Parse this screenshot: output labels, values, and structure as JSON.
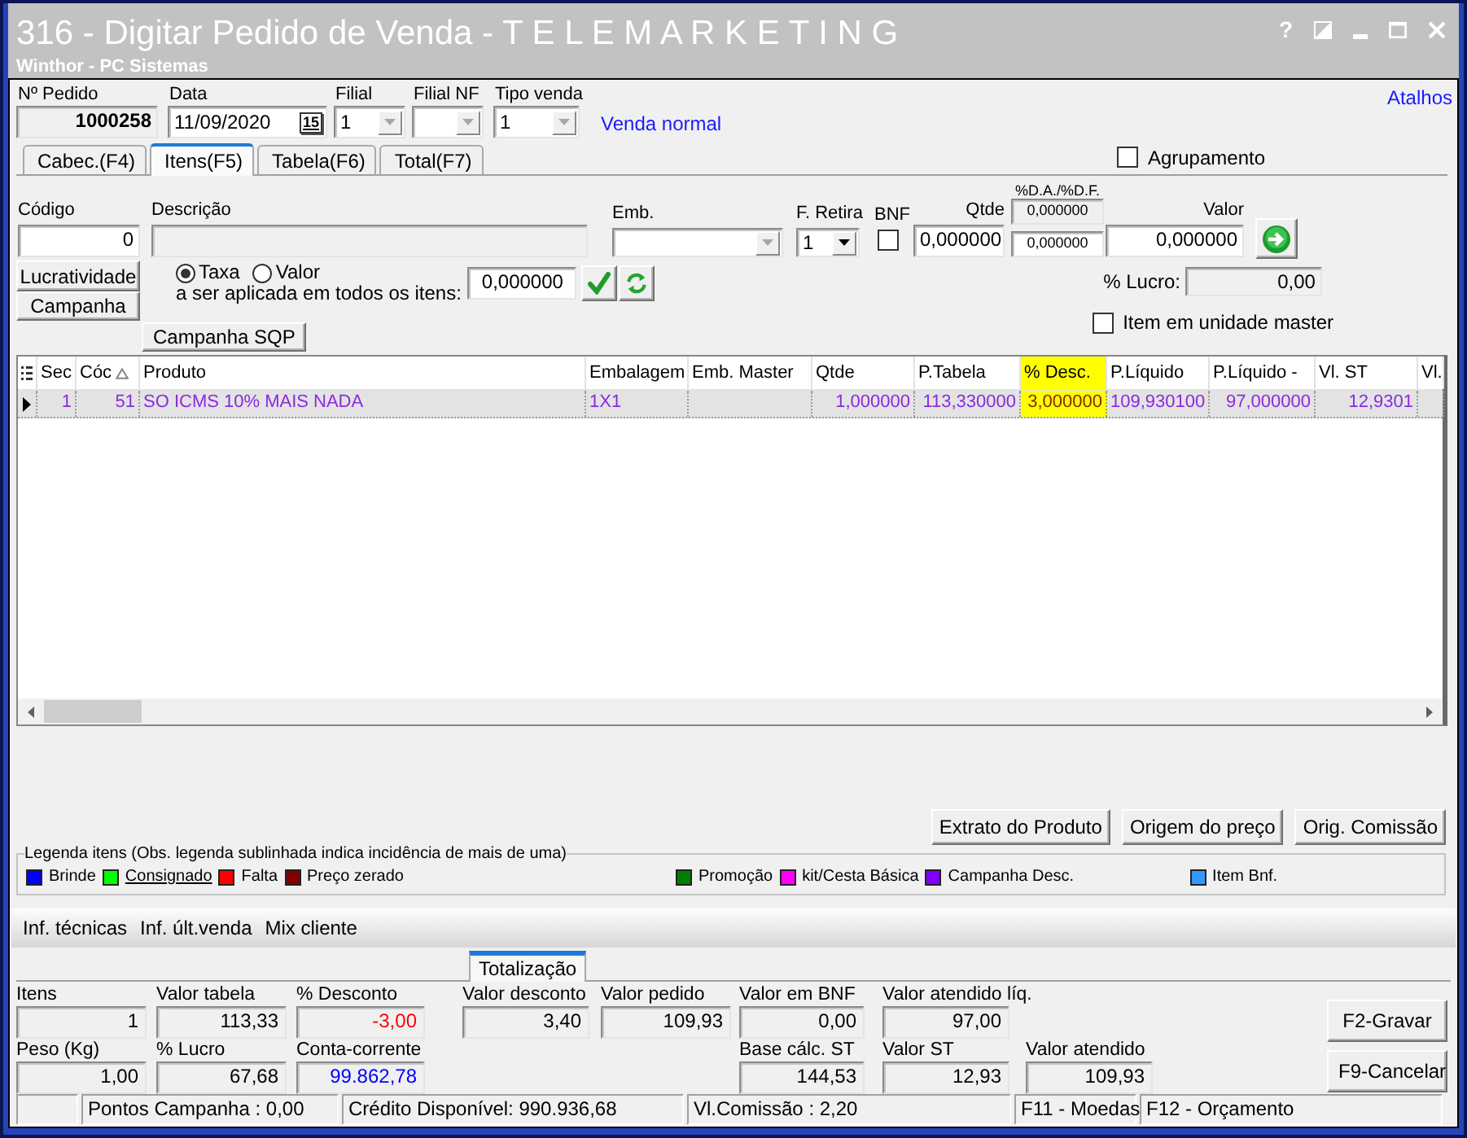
{
  "window": {
    "title": "316 - Digitar Pedido de Venda - T E L E M A R K E T I N G",
    "subtitle": "Winthor - PC Sistemas",
    "help": "?"
  },
  "shortcuts_link": "Atalhos",
  "header_fields": [
    {
      "kind": "text",
      "label": "Nº Pedido",
      "value": "1000258"
    },
    {
      "kind": "date",
      "label": "Data",
      "value": "11/09/2020",
      "button": "15"
    },
    {
      "kind": "dropdown",
      "label": "Filial",
      "value": "1",
      "disabled": true
    },
    {
      "kind": "dropdown",
      "label": "Filial NF",
      "disabled": true
    },
    {
      "kind": "dropdown",
      "label": "Tipo venda",
      "value": "1",
      "disabled": true
    }
  ],
  "sale_type_link": "Venda normal",
  "tabs": [
    {
      "label": "Cabec.(F4)",
      "selected": false
    },
    {
      "label": "Itens(F5)",
      "selected": true
    },
    {
      "label": "Tabela(F6)",
      "selected": false
    },
    {
      "label": "Total(F7)",
      "selected": false
    }
  ],
  "grouping": {
    "label": "Agrupamento",
    "checked": false
  },
  "entry_fields": [
    {
      "kind": "text",
      "label": "Código",
      "value": "0"
    },
    {
      "kind": "readonly",
      "label": "Descrição"
    },
    {
      "kind": "dropdown",
      "label": "Emb.",
      "disabled": true
    },
    {
      "kind": "dropdown",
      "label": "F. Retira",
      "value": "1",
      "disabled": false
    },
    {
      "kind": "checkbox",
      "label": "BNF",
      "checked": false
    },
    {
      "kind": "text",
      "label": "Qtde",
      "value": "0,000000"
    },
    {
      "kind": "pair",
      "label": "%D.A./%D.F.",
      "values": [
        "0,000000",
        "0,000000"
      ]
    },
    {
      "kind": "text",
      "label": "Valor",
      "value": "0,000000"
    }
  ],
  "side_buttons": [
    "Lucratividade",
    "Campanha"
  ],
  "discount": {
    "options": [
      {
        "label": "Taxa",
        "selected": true
      },
      {
        "label": "Valor",
        "selected": false
      }
    ],
    "caption": "a ser aplicada em todos os itens:",
    "value": "0,000000"
  },
  "profit": {
    "label": "% Lucro:",
    "value": "0,00"
  },
  "master_unit": {
    "label": "Item em unidade master",
    "checked": false
  },
  "campaign_sqp_button": "Campanha SQP",
  "items_table": {
    "columns": [
      {
        "label": "Sec",
        "sorted": false,
        "highlighted": false
      },
      {
        "label": "Cóc",
        "sorted": true,
        "highlighted": false
      },
      {
        "label": "Produto",
        "sorted": false,
        "highlighted": false
      },
      {
        "label": "Embalagem",
        "sorted": false,
        "highlighted": false
      },
      {
        "label": "Emb. Master",
        "sorted": false,
        "highlighted": false
      },
      {
        "label": "Qtde",
        "sorted": false,
        "highlighted": false
      },
      {
        "label": "P.Tabela",
        "sorted": false,
        "highlighted": false
      },
      {
        "label": "% Desc.",
        "sorted": false,
        "highlighted": true
      },
      {
        "label": "P.Líquido",
        "sorted": false,
        "highlighted": false
      },
      {
        "label": "P.Líquido -",
        "sorted": false,
        "highlighted": false
      },
      {
        "label": "Vl. ST",
        "sorted": false,
        "highlighted": false
      },
      {
        "label": "Vl.",
        "sorted": false,
        "highlighted": false
      }
    ],
    "rows": [
      {
        "selected": true,
        "color": "#8a2be2",
        "cells": [
          "1",
          "51",
          "SO ICMS 10% MAIS NADA",
          "1X1",
          null,
          "1,000000",
          "113,330000",
          "3,000000",
          "109,930100",
          "97,000000",
          "12,9301",
          null
        ]
      }
    ]
  },
  "product_buttons": [
    "Extrato do Produto",
    "Origem do preço",
    "Orig. Comissão"
  ],
  "legend": {
    "title": "Legenda itens (Obs. legenda sublinhada indica incidência de mais de uma)",
    "items": [
      {
        "label": "Brinde",
        "color": "#0000ff",
        "underlined": false
      },
      {
        "label": "Consignado",
        "color": "#00ff00",
        "underlined": true
      },
      {
        "label": "Falta",
        "color": "#ff0000",
        "underlined": false
      },
      {
        "label": "Preço zerado",
        "color": "#800000",
        "underlined": false
      },
      {
        "label": "Promoção",
        "color": "#008000",
        "underlined": false
      },
      {
        "label": "kit/Cesta Básica",
        "color": "#ff00ff",
        "underlined": false
      },
      {
        "label": "Campanha Desc.",
        "color": "#8000ff",
        "underlined": false
      },
      {
        "label": "Item Bnf.",
        "color": "#3399ff",
        "underlined": false
      }
    ]
  },
  "info_tabs": [
    "Inf. técnicas",
    "Inf. últ.venda",
    "Mix cliente"
  ],
  "totals": {
    "tab": {
      "label": "Totalização",
      "selected": true
    },
    "rows": [
      [
        {
          "label": "Itens",
          "value": "1"
        },
        {
          "label": "Valor tabela",
          "value": "113,33"
        },
        {
          "label": "% Desconto",
          "value": "-3,00",
          "color": "#ff0000"
        },
        {
          "label": "Valor desconto",
          "value": "3,40"
        },
        {
          "label": "Valor pedido",
          "value": "109,93"
        },
        {
          "label": "Valor em BNF",
          "value": "0,00"
        },
        {
          "label": "Valor atendido líq.",
          "value": "97,00"
        }
      ],
      [
        {
          "label": "Peso (Kg)",
          "value": "1,00"
        },
        {
          "label": "% Lucro",
          "value": "67,68"
        },
        {
          "label": "Conta-corrente",
          "value": "99.862,78",
          "color": "#0000ff"
        },
        null,
        null,
        {
          "label": "Base cálc. ST",
          "value": "144,53"
        },
        {
          "label": "Valor ST",
          "value": "12,93"
        },
        {
          "label": "Valor atendido",
          "value": "109,93"
        }
      ]
    ]
  },
  "actions": [
    "F2-Gravar",
    "F9-Cancelar"
  ],
  "status_bar": [
    "Pontos Campanha : 0,00",
    "Crédito Disponível: 990.936,68",
    "Vl.Comissão : 2,20",
    "F11 - Moedas",
    "F12 - Orçamento"
  ]
}
